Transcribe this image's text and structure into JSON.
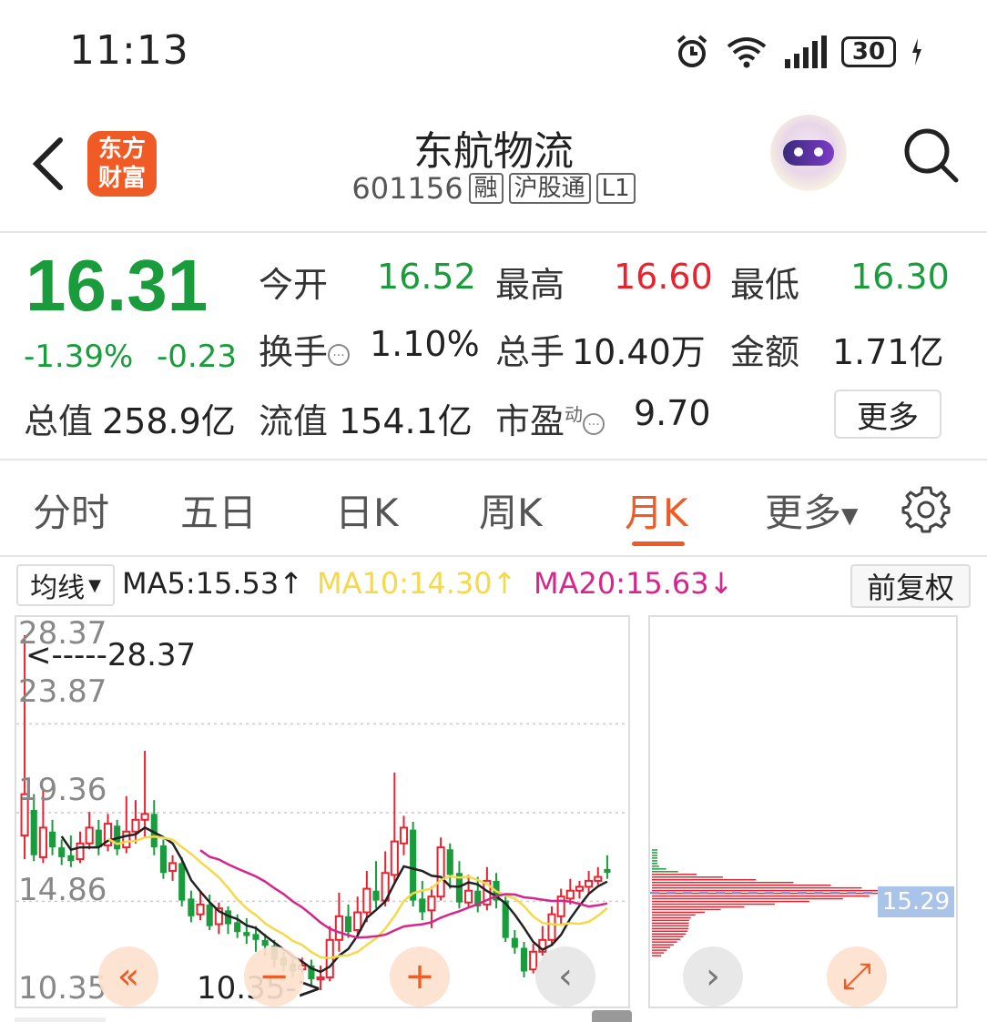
{
  "status": {
    "time": "11:13",
    "battery": "30"
  },
  "header": {
    "logo_line1": "东方",
    "logo_line2": "财富",
    "stock_name": "东航物流",
    "stock_code": "601156",
    "tags": [
      "融",
      "沪股通",
      "L1"
    ]
  },
  "quote": {
    "price": "16.31",
    "change_pct": "-1.39%",
    "change": "-0.23",
    "open_label": "今开",
    "open": "16.52",
    "high_label": "最高",
    "high": "16.60",
    "low_label": "最低",
    "low": "16.30",
    "turnover_label": "换手",
    "turnover": "1.10%",
    "volume_label": "总手",
    "volume": "10.40万",
    "amount_label": "金额",
    "amount": "1.71亿",
    "mktcap_label": "总值",
    "mktcap": "258.9亿",
    "float_label": "流值",
    "float": "154.1亿",
    "pe_label": "市盈",
    "pe_sup": "动",
    "pe": "9.70",
    "more": "更多"
  },
  "tabs": [
    "分时",
    "五日",
    "日K",
    "周K",
    "月K",
    "更多"
  ],
  "active_tab": "月K",
  "ma_bar": {
    "select_label": "均线",
    "ma5": "MA5:15.53",
    "ma10": "MA10:14.30",
    "ma20": "MA20:15.63",
    "ma5_arrow": "↑",
    "ma10_arrow": "↑",
    "ma20_arrow": "↓",
    "fq_button": "前复权"
  },
  "colors": {
    "up": "#e8232f",
    "down": "#1a9c3c",
    "accent": "#f05a24",
    "ma5": "#222222",
    "ma10": "#f5d94a",
    "ma20": "#d6268c"
  },
  "chart": {
    "y_labels": [
      "28.37",
      "23.87",
      "19.36",
      "14.86",
      "10.35"
    ],
    "max_annotation": "<-----28.37",
    "min_annotation": "10.35->",
    "cost_price": "15.29"
  },
  "chart_data": {
    "type": "candlestick",
    "period": "monthly",
    "ylim": [
      10.35,
      28.37
    ],
    "y_ticks": [
      28.37,
      23.87,
      19.36,
      14.86,
      10.35
    ],
    "high_marker": 28.37,
    "low_marker": 10.35,
    "candles": [
      [
        18.2,
        20.3,
        28.37,
        17.0
      ],
      [
        19.5,
        17.2,
        20.3,
        16.9
      ],
      [
        17.1,
        18.6,
        20.5,
        16.8
      ],
      [
        18.4,
        17.6,
        19.0,
        17.2
      ],
      [
        17.6,
        17.1,
        18.0,
        16.7
      ],
      [
        17.2,
        16.9,
        18.2,
        16.6
      ],
      [
        17.0,
        17.8,
        18.4,
        16.8
      ],
      [
        17.8,
        18.6,
        19.4,
        17.5
      ],
      [
        18.5,
        17.6,
        19.0,
        17.2
      ],
      [
        17.7,
        18.8,
        19.3,
        17.4
      ],
      [
        18.7,
        17.5,
        19.0,
        17.2
      ],
      [
        17.6,
        18.4,
        20.2,
        17.3
      ],
      [
        18.4,
        19.0,
        20.0,
        17.8
      ],
      [
        19.0,
        19.3,
        22.5,
        18.1
      ],
      [
        19.3,
        17.6,
        20.0,
        17.2
      ],
      [
        17.7,
        16.3,
        18.0,
        16.0
      ],
      [
        16.4,
        16.8,
        17.2,
        15.9
      ],
      [
        16.8,
        14.9,
        17.1,
        14.6
      ],
      [
        15.0,
        14.1,
        15.4,
        13.8
      ],
      [
        14.2,
        14.7,
        15.3,
        13.9
      ],
      [
        14.7,
        13.6,
        15.2,
        13.4
      ],
      [
        13.7,
        14.5,
        14.8,
        13.2
      ],
      [
        14.4,
        13.7,
        14.6,
        13.2
      ],
      [
        13.8,
        13.3,
        14.2,
        13.0
      ],
      [
        13.3,
        13.1,
        14.0,
        12.7
      ],
      [
        13.2,
        12.9,
        13.6,
        12.3
      ],
      [
        12.9,
        12.6,
        13.2,
        12.1
      ],
      [
        12.6,
        11.9,
        12.9,
        11.5
      ],
      [
        12.0,
        11.6,
        12.3,
        11.3
      ],
      [
        11.7,
        11.3,
        12.0,
        11.0
      ],
      [
        11.4,
        11.6,
        12.0,
        11.2
      ],
      [
        11.6,
        10.9,
        11.9,
        10.6
      ],
      [
        10.9,
        11.0,
        11.6,
        10.35
      ],
      [
        11.0,
        12.9,
        13.6,
        10.8
      ],
      [
        12.9,
        14.1,
        15.3,
        12.3
      ],
      [
        14.1,
        13.3,
        14.7,
        13.0
      ],
      [
        13.4,
        14.3,
        15.1,
        13.2
      ],
      [
        14.3,
        15.5,
        16.4,
        13.8
      ],
      [
        15.4,
        14.9,
        16.9,
        14.5
      ],
      [
        14.9,
        16.3,
        17.4,
        14.6
      ],
      [
        16.2,
        17.9,
        21.4,
        15.8
      ],
      [
        17.8,
        18.6,
        19.2,
        17.2
      ],
      [
        18.5,
        14.9,
        18.9,
        14.6
      ],
      [
        15.0,
        14.3,
        15.9,
        13.9
      ],
      [
        14.4,
        15.1,
        15.6,
        13.5
      ],
      [
        15.1,
        17.6,
        18.1,
        14.9
      ],
      [
        17.5,
        16.2,
        17.8,
        15.5
      ],
      [
        16.3,
        14.8,
        16.9,
        14.5
      ],
      [
        14.8,
        15.4,
        16.2,
        14.6
      ],
      [
        15.4,
        14.6,
        16.1,
        14.3
      ],
      [
        14.7,
        15.9,
        16.6,
        14.4
      ],
      [
        15.9,
        14.9,
        16.3,
        14.5
      ],
      [
        14.9,
        13.0,
        15.1,
        12.8
      ],
      [
        13.0,
        12.5,
        13.4,
        12.2
      ],
      [
        12.5,
        11.3,
        12.8,
        11.0
      ],
      [
        11.4,
        12.3,
        12.7,
        11.2
      ],
      [
        12.3,
        12.9,
        13.6,
        12.1
      ],
      [
        12.9,
        14.2,
        14.6,
        12.6
      ],
      [
        14.1,
        15.1,
        15.5,
        13.7
      ],
      [
        15.0,
        15.4,
        16.0,
        14.7
      ],
      [
        15.4,
        15.6,
        15.9,
        15.0
      ],
      [
        15.6,
        15.9,
        16.4,
        15.2
      ],
      [
        15.9,
        16.1,
        16.6,
        15.7
      ],
      [
        16.5,
        16.31,
        17.2,
        16.0
      ]
    ],
    "ma_series": [
      {
        "name": "MA5",
        "last": 15.53
      },
      {
        "name": "MA10",
        "last": 14.3
      },
      {
        "name": "MA20",
        "last": 15.63
      }
    ],
    "volume_profile_price": 15.29
  }
}
